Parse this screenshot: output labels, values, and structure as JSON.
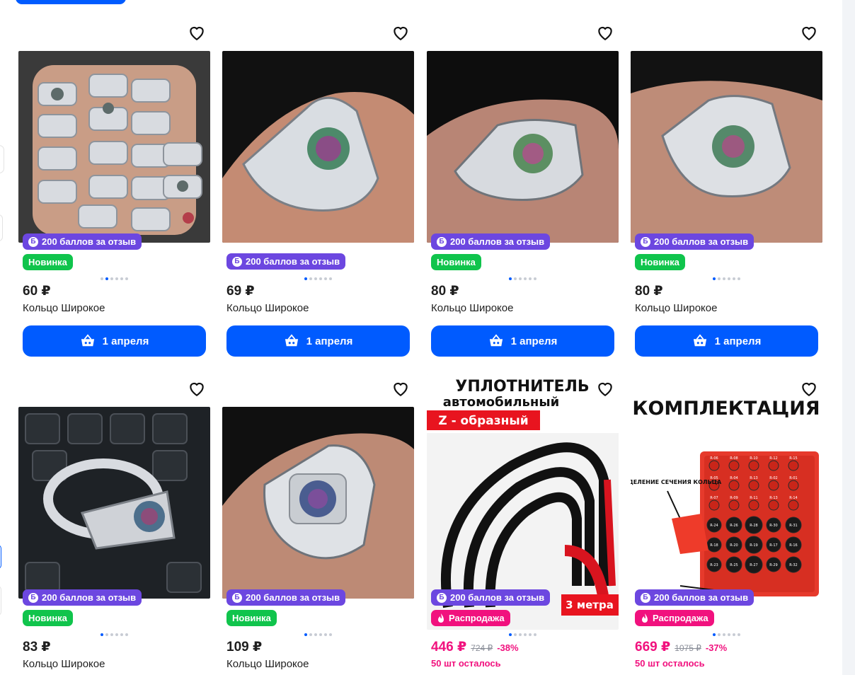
{
  "products": [
    {
      "price": "60 ₽",
      "title": "Кольцо Широкое",
      "badges": [
        {
          "type": "points",
          "text": "200 баллов за отзыв"
        },
        {
          "type": "new",
          "text": "Новинка"
        }
      ],
      "button": "1 апреля",
      "active_dot": 1
    },
    {
      "price": "69 ₽",
      "title": "Кольцо Широкое",
      "badges": [
        {
          "type": "points",
          "text": "200 баллов за отзыв"
        }
      ],
      "button": "1 апреля",
      "active_dot": 0
    },
    {
      "price": "80 ₽",
      "title": "Кольцо Широкое",
      "badges": [
        {
          "type": "points",
          "text": "200 баллов за отзыв"
        },
        {
          "type": "new",
          "text": "Новинка"
        }
      ],
      "button": "1 апреля",
      "active_dot": 0
    },
    {
      "price": "80 ₽",
      "title": "Кольцо Широкое",
      "badges": [
        {
          "type": "points",
          "text": "200 баллов за отзыв"
        },
        {
          "type": "new",
          "text": "Новинка"
        }
      ],
      "button": "1 апреля",
      "active_dot": 0
    },
    {
      "price": "83 ₽",
      "title": "Кольцо Широкое",
      "badges": [
        {
          "type": "points",
          "text": "200 баллов за отзыв"
        },
        {
          "type": "new",
          "text": "Новинка"
        }
      ],
      "active_dot": 0
    },
    {
      "price": "109 ₽",
      "title": "Кольцо Широкое",
      "badges": [
        {
          "type": "points",
          "text": "200 баллов за отзыв"
        },
        {
          "type": "new",
          "text": "Новинка"
        }
      ],
      "active_dot": 0
    },
    {
      "price": "446 ₽",
      "old_price": "724 ₽",
      "discount": "-38%",
      "stock": "50 шт осталось",
      "badges": [
        {
          "type": "points",
          "text": "200 баллов за отзыв"
        },
        {
          "type": "sale",
          "text": "Распродажа"
        }
      ],
      "active_dot": 0,
      "promo": {
        "line1": "УПЛОТНИТЕЛЬ",
        "line2": "автомобильный",
        "line3": "Z - образный",
        "tag": "3 метра"
      }
    },
    {
      "price": "669 ₽",
      "old_price": "1075 ₽",
      "discount": "-37%",
      "stock": "50 шт осталось",
      "badges": [
        {
          "type": "points",
          "text": "200 баллов за отзыв"
        },
        {
          "type": "sale",
          "text": "Распродажа"
        }
      ],
      "active_dot": 0,
      "promo": {
        "heading": "КОМПЛЕКТАЦИЯ",
        "note": "ОПРЕДЕЛЕНИЕ СЕЧЕНИЯ КОЛЬЦА",
        "ring_labels": [
          "R-06",
          "R-08",
          "R-10",
          "R-12",
          "R-15",
          "R-05",
          "R-04",
          "R-13",
          "R-02",
          "R-01",
          "R-07",
          "R-09",
          "R-11",
          "R-13",
          "R-14",
          "R-24",
          "R-26",
          "R-28",
          "R-30",
          "R-31",
          "R-18",
          "R-20",
          "R-19",
          "R-17",
          "R-16",
          "R-23",
          "R-25",
          "R-27",
          "R-29",
          "R-32"
        ]
      }
    }
  ],
  "colors": {
    "accent": "#005bff",
    "points": "#6c47e0",
    "new": "#10c44c",
    "sale": "#f1117e"
  },
  "icons": {
    "favorite": "heart-icon",
    "cart": "basket-icon",
    "points": "b-coin-icon",
    "sale": "fire-icon"
  }
}
